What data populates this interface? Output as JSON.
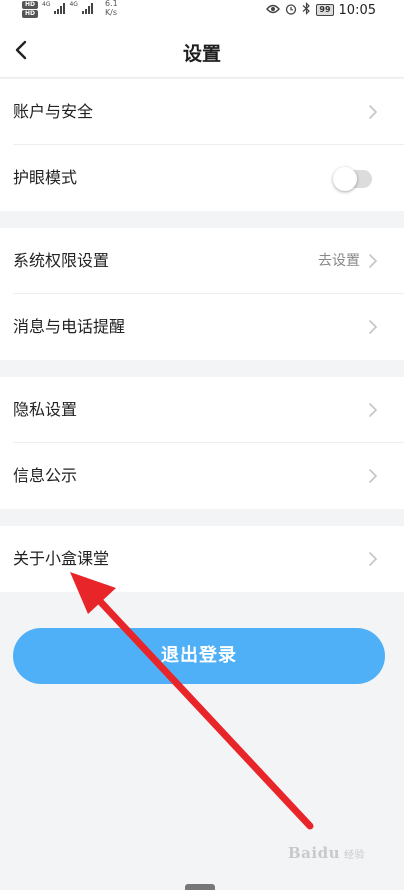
{
  "status_bar": {
    "hd_badges": [
      "HD",
      "HD"
    ],
    "network_tags": [
      "4G",
      "4G"
    ],
    "speed_value": "6.1",
    "speed_unit": "K/s",
    "battery_level": "99",
    "time": "10:05"
  },
  "header": {
    "title": "设置"
  },
  "groups": [
    {
      "items": [
        {
          "label": "账户与安全",
          "type": "link"
        },
        {
          "label": "护眼模式",
          "type": "toggle",
          "toggle_on": false
        }
      ]
    },
    {
      "items": [
        {
          "label": "系统权限设置",
          "type": "link",
          "value": "去设置"
        },
        {
          "label": "消息与电话提醒",
          "type": "link"
        }
      ]
    },
    {
      "items": [
        {
          "label": "隐私设置",
          "type": "link"
        },
        {
          "label": "信息公示",
          "type": "link"
        }
      ]
    },
    {
      "items": [
        {
          "label": "关于小盒课堂",
          "type": "link"
        }
      ]
    }
  ],
  "logout_label": "退出登录",
  "watermark": {
    "text": "Baidu",
    "sub": "经验"
  },
  "colors": {
    "accent": "#4fb0f8",
    "background": "#f3f4f6",
    "annotation_arrow": "#e8262a"
  }
}
